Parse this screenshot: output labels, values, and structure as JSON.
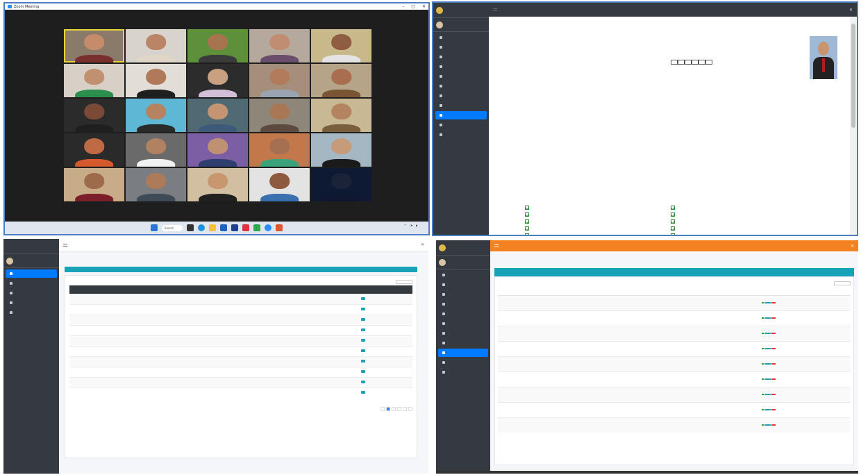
{
  "zoom": {
    "title": "Zoom Meeting",
    "participants": [
      {
        "name": "",
        "skin": "#c58c6b",
        "shirt": "#7a2f2f",
        "bg": "#8a7a6a",
        "highlight": true
      },
      {
        "name": "",
        "skin": "#b98566",
        "shirt": "#e0d6c8",
        "bg": "#d8d3cc"
      },
      {
        "name": "",
        "skin": "#a8734f",
        "shirt": "#3b3b3b",
        "bg": "#5e8f3a"
      },
      {
        "name": "",
        "skin": "#c08d70",
        "shirt": "#6b4e6b",
        "bg": "#b4a99c"
      },
      {
        "name": "",
        "skin": "#8f5e42",
        "shirt": "#e4e4e4",
        "bg": "#c9b88a"
      },
      {
        "name": "",
        "skin": "#c09070",
        "shirt": "#2d8f4e",
        "bg": "#d7d0c6"
      },
      {
        "name": "",
        "skin": "#b07a5a",
        "shirt": "#1f1f1f",
        "bg": "#e2ddd6"
      },
      {
        "name": "",
        "skin": "#c9a080",
        "shirt": "#d3c0d8",
        "bg": "#2c2c2c"
      },
      {
        "name": "",
        "skin": "#b27b5c",
        "shirt": "#9aa3b0",
        "bg": "#a68f7a"
      },
      {
        "name": "",
        "skin": "#a86e4f",
        "shirt": "#7a5534",
        "bg": "#b6a488"
      },
      {
        "name": "",
        "skin": "#7a4a36",
        "shirt": "#1f1f1f",
        "bg": "#2b2b2b"
      },
      {
        "name": "",
        "skin": "#b5835f",
        "shirt": "#2a2a2a",
        "bg": "#5fb7d6"
      },
      {
        "name": "",
        "skin": "#c49473",
        "shirt": "#3d5a7a",
        "bg": "#4f6a73"
      },
      {
        "name": "",
        "skin": "#a77756",
        "shirt": "#5c4a3f",
        "bg": "#8e8679"
      },
      {
        "name": "",
        "skin": "#b48460",
        "shirt": "#7b5f3d",
        "bg": "#c8b994"
      },
      {
        "name": "",
        "skin": "#c06a45",
        "shirt": "#d45a2e",
        "bg": "#2a2a2a"
      },
      {
        "name": "",
        "skin": "#b18262",
        "shirt": "#f2f2f2",
        "bg": "#6a6a6a"
      },
      {
        "name": "",
        "skin": "#bf9071",
        "shirt": "#2e3e6f",
        "bg": "#7c5ea4"
      },
      {
        "name": "",
        "skin": "#a56f52",
        "shirt": "#3ba37c",
        "bg": "#c2784a"
      },
      {
        "name": "",
        "skin": "#c59b7a",
        "shirt": "#1a1a1a",
        "bg": "#a4b7c2"
      },
      {
        "name": "",
        "skin": "#9e6a4c",
        "shirt": "#7c1f2a",
        "bg": "#c8ac88"
      },
      {
        "name": "",
        "skin": "#ad7b5a",
        "shirt": "#3e4a56",
        "bg": "#7a7e82"
      },
      {
        "name": "",
        "skin": "#c9976f",
        "shirt": "#202020",
        "bg": "#d2bfa2"
      },
      {
        "name": "",
        "skin": "#8d5a3f",
        "shirt": "#3a6fb0",
        "bg": "#e3e3e3"
      },
      {
        "name": "",
        "skin": "#1a2338",
        "shirt": "#0f1830",
        "bg": "#0e1a33"
      }
    ],
    "taskbar": {
      "search_label": "Search",
      "time": "",
      "date": ""
    }
  },
  "doc": {
    "top_title": "",
    "brand": "",
    "user": "",
    "nav": [
      "",
      "",
      "",
      "",
      "",
      "",
      "",
      "",
      "",
      "",
      ""
    ],
    "active_index": 8,
    "id_label": "",
    "id_cells": [
      "",
      "",
      "",
      "",
      "",
      ""
    ],
    "heading_lines": [
      "",
      "",
      ""
    ],
    "body_lines": [
      "",
      "",
      ""
    ],
    "checks": [
      "",
      "",
      "",
      "",
      "",
      "",
      "",
      "",
      "",
      ""
    ]
  },
  "table_page": {
    "brand": "",
    "user": "",
    "nav": [
      "",
      "",
      "",
      "",
      ""
    ],
    "active_index": 0,
    "top_title": "",
    "page_title": "",
    "breadcrumb": "",
    "show_label": "",
    "search_label": "",
    "columns": [
      "",
      "",
      "",
      "",
      "",
      ""
    ],
    "rows": [
      [
        "",
        "",
        "",
        "",
        "",
        ""
      ],
      [
        "",
        "",
        "",
        "",
        "",
        ""
      ],
      [
        "",
        "",
        "",
        "",
        "",
        ""
      ],
      [
        "",
        "",
        "",
        "",
        "",
        ""
      ],
      [
        "",
        "",
        "",
        "",
        "",
        ""
      ],
      [
        "",
        "",
        "",
        "",
        "",
        ""
      ],
      [
        "",
        "",
        "",
        "",
        "",
        ""
      ],
      [
        "",
        "",
        "",
        "",
        "",
        ""
      ],
      [
        "",
        "",
        "",
        "",
        "",
        ""
      ],
      [
        "",
        "",
        "",
        "",
        "",
        ""
      ]
    ],
    "pages": [
      "",
      "1",
      "",
      "",
      "",
      ""
    ]
  },
  "list_page": {
    "brand": "",
    "user": "",
    "nav": [
      "",
      "",
      "",
      "",
      "",
      "",
      "",
      "",
      "",
      "",
      ""
    ],
    "active_index": 8,
    "top_title": "",
    "page_title": "",
    "breadcrumb": "",
    "card_title": "",
    "search_label": "",
    "columns": [
      "",
      "",
      "",
      "",
      "",
      ""
    ],
    "rows": [
      [
        "",
        "",
        "",
        "",
        ""
      ],
      [
        "",
        "",
        "",
        "",
        ""
      ],
      [
        "",
        "",
        "",
        "",
        ""
      ],
      [
        "",
        "",
        "",
        "",
        ""
      ],
      [
        "",
        "",
        "",
        "",
        ""
      ],
      [
        "",
        "",
        "",
        "",
        ""
      ],
      [
        "",
        "",
        "",
        "",
        ""
      ],
      [
        "",
        "",
        "",
        "",
        ""
      ],
      [
        "",
        "",
        "",
        "",
        ""
      ]
    ],
    "action_labels": [
      "",
      "",
      ""
    ]
  },
  "colors": {
    "primary": "#007bff",
    "teal": "#17a2b8",
    "orange": "#f58220",
    "dark": "#343a40",
    "zoom_bg": "#1e1e1e"
  }
}
